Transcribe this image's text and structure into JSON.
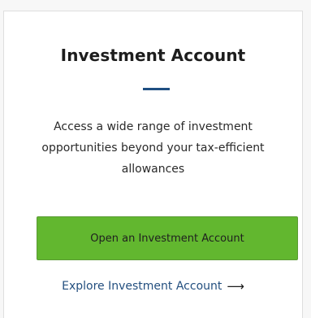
{
  "card": {
    "title": "Investment Account",
    "description_lines": [
      "Access a wide range of investment",
      "opportunities beyond your tax-efficient",
      "allowances"
    ],
    "cta_button_label": "Open an Investment Account",
    "explore_link_label": "Explore Investment Account",
    "arrow_glyph": "⟶"
  },
  "colors": {
    "accent_divider": "#1f4f82",
    "cta_green": "#62b72f",
    "link_blue": "#234f7f"
  },
  "icons": {
    "explore_arrow": "arrow-right-icon"
  }
}
